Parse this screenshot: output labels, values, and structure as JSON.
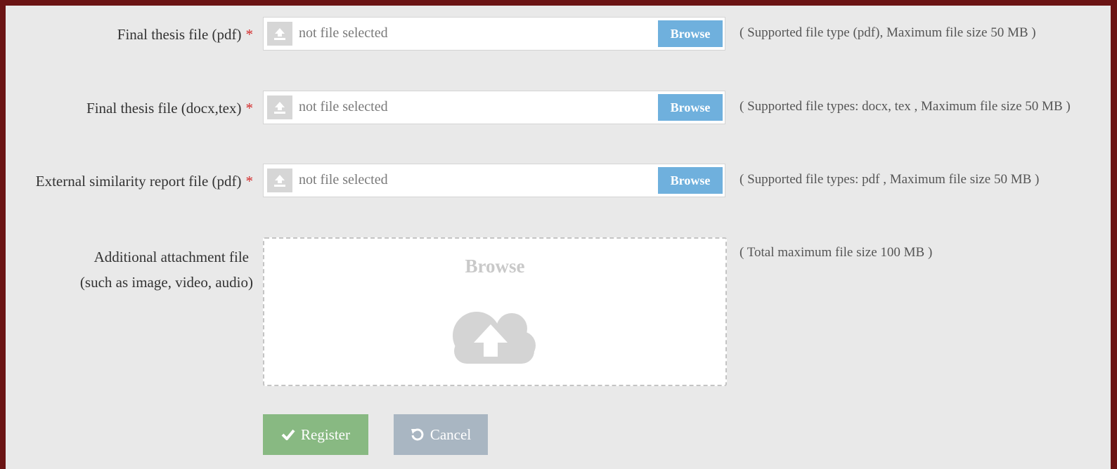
{
  "fields": [
    {
      "label": "Final thesis file (pdf)",
      "required_mark": "*",
      "value": "not file selected",
      "browse_label": "Browse",
      "hint": "( Supported file type (pdf), Maximum file size 50 MB )"
    },
    {
      "label": "Final thesis file (docx,tex)",
      "required_mark": "*",
      "value": "not file selected",
      "browse_label": "Browse",
      "hint": "( Supported file types: docx, tex , Maximum file size 50 MB )"
    },
    {
      "label": "External similarity report file (pdf)",
      "required_mark": "*",
      "value": "not file selected",
      "browse_label": "Browse",
      "hint": "( Supported file types: pdf , Maximum file size 50 MB )"
    }
  ],
  "attachment": {
    "label_line1": "Additional attachment file",
    "label_line2": "(such as image, video, audio)",
    "browse_label": "Browse",
    "hint": "( Total maximum file size 100 MB )",
    "icon": "cloud-upload-icon"
  },
  "actions": {
    "register_label": "Register",
    "register_icon": "check-icon",
    "cancel_label": "Cancel",
    "cancel_icon": "undo-icon"
  },
  "colors": {
    "frame": "#6b1414",
    "background": "#e9e9e9",
    "browse_button": "#6fb0dd",
    "register_button": "#88b982",
    "cancel_button": "#a9b6c2",
    "required": "#d42b2b"
  }
}
